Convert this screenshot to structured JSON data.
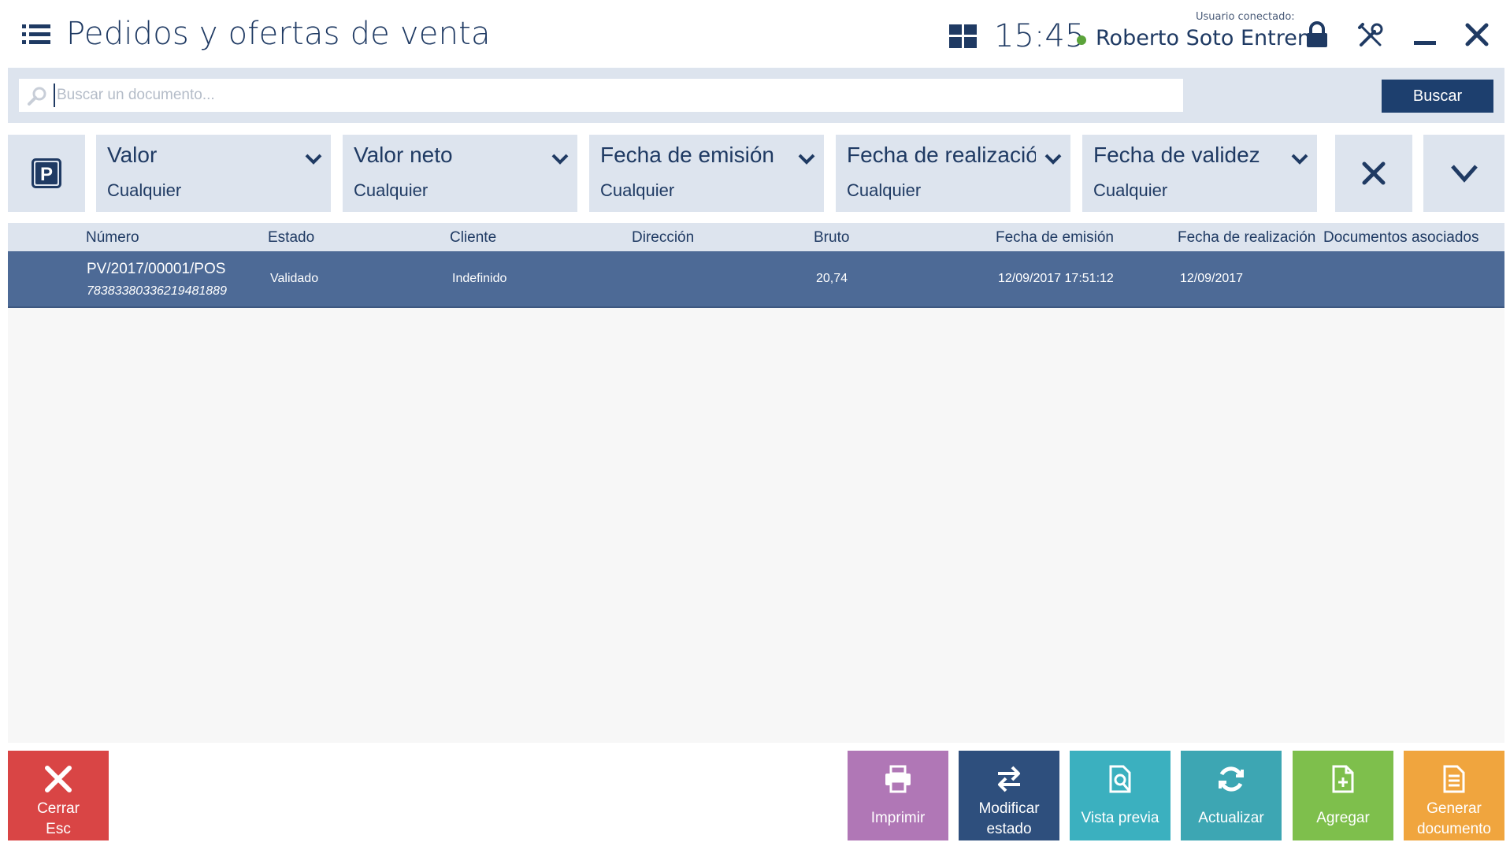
{
  "header": {
    "title": "Pedidos y ofertas de venta",
    "clock": "15:45",
    "user_caption": "Usuario conectado:",
    "user_name": "Roberto Soto Entrena",
    "status_color": "#5ba33a"
  },
  "search": {
    "placeholder": "Buscar un documento...",
    "value": "",
    "button_label": "Buscar"
  },
  "filters": [
    {
      "label": "Valor",
      "value": "Cualquier"
    },
    {
      "label": "Valor neto",
      "value": "Cualquier"
    },
    {
      "label": "Fecha de emisión",
      "value": "Cualquier"
    },
    {
      "label": "Fecha de realización",
      "value": "Cualquier"
    },
    {
      "label": "Fecha de validez",
      "value": "Cualquier"
    }
  ],
  "park_label": "P",
  "table": {
    "columns": [
      "Número",
      "Estado",
      "Cliente",
      "Dirección",
      "Bruto",
      "Fecha de emisión",
      "Fecha de realización",
      "Documentos asociados"
    ],
    "rows": [
      {
        "numero": "PV/2017/00001/POS",
        "codigo": "7838338033621948188​9",
        "estado": "Validado",
        "cliente": "Indefinido",
        "direccion": "",
        "bruto": "20,74",
        "fecha_emision": "12/09/2017 17:51:12",
        "fecha_realizacion": "12/09/2017",
        "documentos_asociados": ""
      }
    ]
  },
  "actions": {
    "close_label": "Cerrar",
    "close_shortcut": "Esc",
    "print_label": "Imprimir",
    "modify_label_1": "Modificar",
    "modify_label_2": "estado",
    "preview_label": "Vista previa",
    "refresh_label": "Actualizar",
    "add_label": "Agregar",
    "generate_label_1": "Generar",
    "generate_label_2": "documento"
  },
  "colors": {
    "primary": "#1f3a63",
    "selected_row": "#4d6a96",
    "panel": "#dde4ee",
    "close": "#d94545",
    "print": "#b077b6",
    "modify": "#2e4f7d",
    "preview": "#3bb0bf",
    "refresh": "#3da6b3",
    "add": "#7ebf4c",
    "generate": "#f0a53e"
  }
}
